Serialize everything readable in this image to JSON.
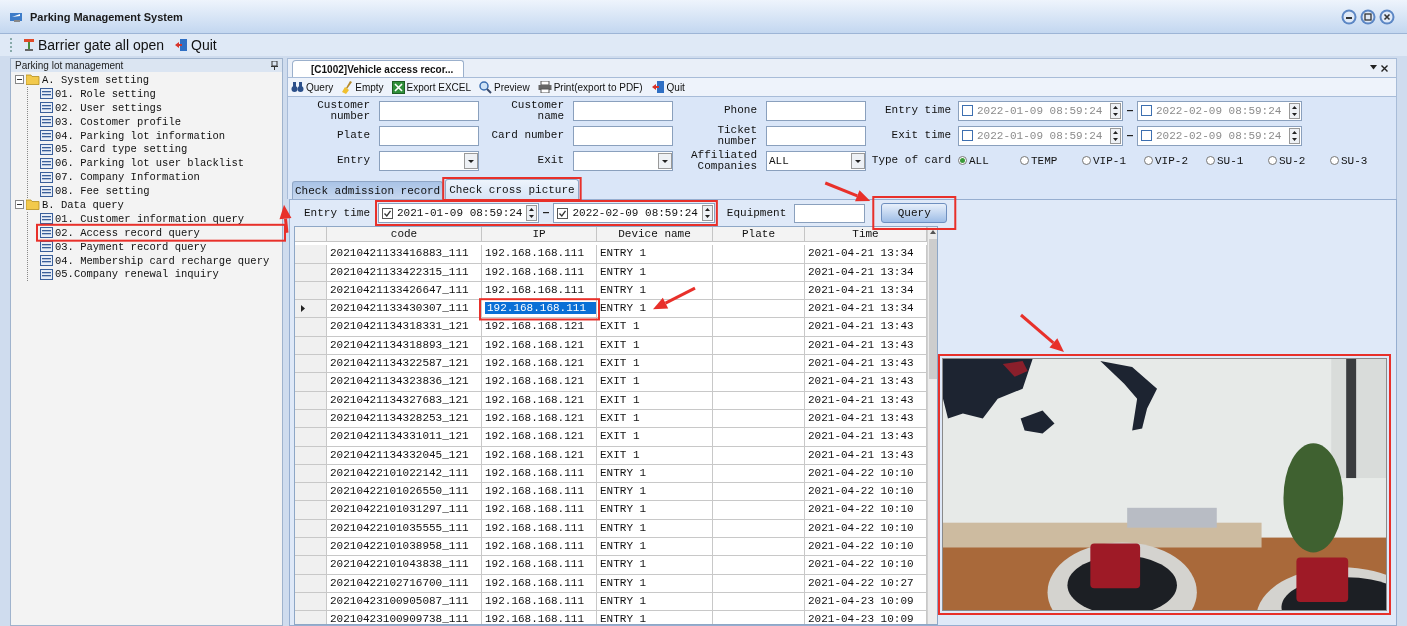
{
  "window": {
    "title": "Parking Management System"
  },
  "toolbar": [
    {
      "label": "Barrier gate all open",
      "kind": "barrier"
    },
    {
      "label": "Quit",
      "kind": "quit"
    }
  ],
  "sidebar": {
    "title": "Parking lot management",
    "tree": [
      {
        "label": "A. System setting",
        "expanded": true,
        "children": [
          {
            "label": "01. Role setting"
          },
          {
            "label": "02. User settings"
          },
          {
            "label": "03. Costomer profile"
          },
          {
            "label": "04. Parking lot information"
          },
          {
            "label": "05. Card type setting"
          },
          {
            "label": "06. Parking lot user blacklist"
          },
          {
            "label": "07. Company Information"
          },
          {
            "label": "08. Fee setting"
          }
        ]
      },
      {
        "label": "B. Data query",
        "expanded": true,
        "children": [
          {
            "label": "01. Customer information query"
          },
          {
            "label": "02. Access record query"
          },
          {
            "label": "03. Payment record query"
          },
          {
            "label": "04. Membership card recharge query"
          },
          {
            "label": "05.Company renewal inquiry"
          }
        ]
      }
    ]
  },
  "document_tabs": [
    {
      "label": "[C1002]Vehicle access recor..."
    }
  ],
  "actions": [
    {
      "label": "Query",
      "kind": "query"
    },
    {
      "label": "Empty",
      "kind": "empty"
    },
    {
      "label": "Export EXCEL",
      "kind": "excel"
    },
    {
      "label": "Preview",
      "kind": "preview"
    },
    {
      "label": "Print(export to PDF)",
      "kind": "print"
    },
    {
      "label": "Quit",
      "kind": "quit"
    }
  ],
  "form": [
    {
      "label": "Customer number",
      "kind": "text"
    },
    {
      "label": "Customer name",
      "kind": "text"
    },
    {
      "label": "Phone",
      "kind": "text"
    },
    {
      "label": "Entry time",
      "kind": "daterange",
      "from": {
        "value": "2022-01-09 08:59:24",
        "checked": false
      },
      "to": {
        "value": "2022-02-09 08:59:24",
        "checked": false
      }
    },
    {
      "label": "Plate",
      "kind": "text"
    },
    {
      "label": "Card number",
      "kind": "text"
    },
    {
      "label": "Ticket number",
      "kind": "text"
    },
    {
      "label": "Exit time",
      "kind": "daterange",
      "from": {
        "value": "2022-01-09 08:59:24",
        "checked": false
      },
      "to": {
        "value": "2022-02-09 08:59:24",
        "checked": false
      }
    },
    {
      "label": "Entry",
      "kind": "combo"
    },
    {
      "label": "Exit",
      "kind": "combo"
    },
    {
      "label": "Affiliated Companies",
      "kind": "combo",
      "value": "ALL"
    },
    {
      "label": "Type of card",
      "kind": "radio",
      "options": [
        {
          "label": "ALL",
          "selected": true
        },
        {
          "label": "TEMP",
          "selected": false
        },
        {
          "label": "VIP-1",
          "selected": false
        },
        {
          "label": "VIP-2",
          "selected": false
        },
        {
          "label": "SU-1",
          "selected": false
        },
        {
          "label": "SU-2",
          "selected": false
        },
        {
          "label": "SU-3",
          "selected": false
        }
      ]
    }
  ],
  "result_tabs": [
    {
      "label": "Check admission record",
      "selected": false
    },
    {
      "label": "Check cross picture",
      "selected": true
    }
  ],
  "query_bar": {
    "label": "Entry time",
    "from": {
      "value": "2021-01-09 08:59:24",
      "checked": true
    },
    "to": {
      "value": "2022-02-09 08:59:24",
      "checked": true
    },
    "equipment_label": "Equipment",
    "button": "Query"
  },
  "table": {
    "columns": [
      "code",
      "IP",
      "Device name",
      "Plate",
      "Time"
    ],
    "rows": [
      {
        "code": "20210421133416883_111",
        "ip": "192.168.168.111",
        "device": "ENTRY 1",
        "time": "2021-04-21 13:34",
        "selected": false
      },
      {
        "code": "20210421133422315_111",
        "ip": "192.168.168.111",
        "device": "ENTRY 1",
        "time": "2021-04-21 13:34",
        "selected": false
      },
      {
        "code": "20210421133426647_111",
        "ip": "192.168.168.111",
        "device": "ENTRY 1",
        "time": "2021-04-21 13:34",
        "selected": false
      },
      {
        "code": "20210421133430307_111",
        "ip": "192.168.168.111",
        "device": "ENTRY 1",
        "time": "2021-04-21 13:34",
        "selected": true
      },
      {
        "code": "20210421134318331_121",
        "ip": "192.168.168.121",
        "device": "EXIT 1",
        "time": "2021-04-21 13:43",
        "selected": false
      },
      {
        "code": "20210421134318893_121",
        "ip": "192.168.168.121",
        "device": "EXIT 1",
        "time": "2021-04-21 13:43",
        "selected": false
      },
      {
        "code": "20210421134322587_121",
        "ip": "192.168.168.121",
        "device": "EXIT 1",
        "time": "2021-04-21 13:43",
        "selected": false
      },
      {
        "code": "20210421134323836_121",
        "ip": "192.168.168.121",
        "device": "EXIT 1",
        "time": "2021-04-21 13:43",
        "selected": false
      },
      {
        "code": "20210421134327683_121",
        "ip": "192.168.168.121",
        "device": "EXIT 1",
        "time": "2021-04-21 13:43",
        "selected": false
      },
      {
        "code": "20210421134328253_121",
        "ip": "192.168.168.121",
        "device": "EXIT 1",
        "time": "2021-04-21 13:43",
        "selected": false
      },
      {
        "code": "20210421134331011_121",
        "ip": "192.168.168.121",
        "device": "EXIT 1",
        "time": "2021-04-21 13:43",
        "selected": false
      },
      {
        "code": "20210421134332045_121",
        "ip": "192.168.168.121",
        "device": "EXIT 1",
        "time": "2021-04-21 13:43",
        "selected": false
      },
      {
        "code": "20210422101022142_111",
        "ip": "192.168.168.111",
        "device": "ENTRY 1",
        "time": "2021-04-22 10:10",
        "selected": false
      },
      {
        "code": "20210422101026550_111",
        "ip": "192.168.168.111",
        "device": "ENTRY 1",
        "time": "2021-04-22 10:10",
        "selected": false
      },
      {
        "code": "20210422101031297_111",
        "ip": "192.168.168.111",
        "device": "ENTRY 1",
        "time": "2021-04-22 10:10",
        "selected": false
      },
      {
        "code": "20210422101035555_111",
        "ip": "192.168.168.111",
        "device": "ENTRY 1",
        "time": "2021-04-22 10:10",
        "selected": false
      },
      {
        "code": "20210422101038958_111",
        "ip": "192.168.168.111",
        "device": "ENTRY 1",
        "time": "2021-04-22 10:10",
        "selected": false
      },
      {
        "code": "20210422101043838_111",
        "ip": "192.168.168.111",
        "device": "ENTRY 1",
        "time": "2021-04-22 10:10",
        "selected": false
      },
      {
        "code": "20210422102716700_111",
        "ip": "192.168.168.111",
        "device": "ENTRY 1",
        "time": "2021-04-22 10:27",
        "selected": false
      },
      {
        "code": "20210423100905087_111",
        "ip": "192.168.168.111",
        "device": "ENTRY 1",
        "time": "2021-04-23 10:09",
        "selected": false
      },
      {
        "code": "20210423100909738_111",
        "ip": "192.168.168.111",
        "device": "ENTRY 1",
        "time": "2021-04-23 10:09",
        "selected": false
      }
    ]
  }
}
